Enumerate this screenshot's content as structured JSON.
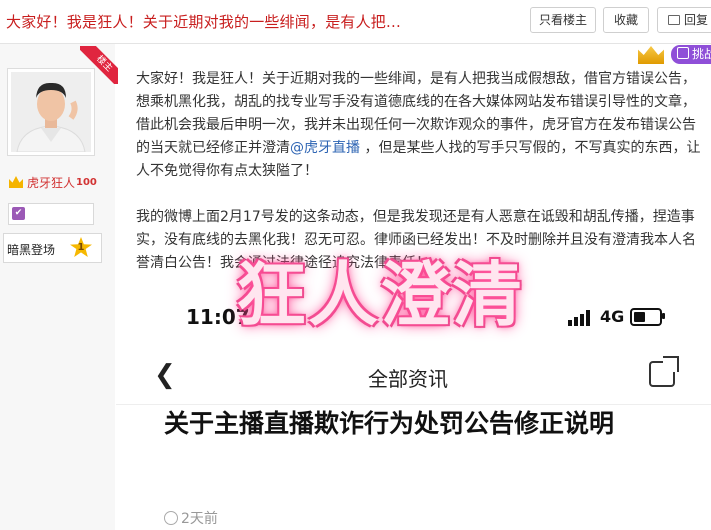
{
  "header": {
    "thread_title": "大家好！我是狂人！关于近期对我的一些绯闻，是有人把...",
    "only_op_label": "只看楼主",
    "favorite_label": "收藏",
    "reply_label": "回复"
  },
  "badges": {
    "louzhu_label": "楼主",
    "challenge_label": "挑战"
  },
  "author": {
    "name": "虎牙狂人",
    "name_suffix_icon": "100-emoji-icon",
    "level_name": "暗黑登场",
    "level_number": "1"
  },
  "post": {
    "para1_before_mention": "大家好！我是狂人！关于近期对我的一些绯闻，是有人把我当成假想敌，借官方错误公告，想乘机黑化我，胡乱的找专业写手没有道德底线的在各大媒体网站发布错误引导性的文章，借此机会我最后申明一次，我并未出现任何一次欺诈观众的事件，虎牙官方在发布错误公告的当天就已经修正并澄清",
    "mention": "@虎牙直播",
    "para1_after_mention": " ，但是某些人找的写手只写假的，不写真实的东西，让人不免觉得你有点太狭隘了！",
    "para2": "我的微博上面2月17号发的这条动态，但是我发现还是有人恶意在诋毁和胡乱传播，捏造事实，没有底线的去黑化我！忍无可忍。律师函已经发出！不及时删除并且没有澄清我本人名誉清白公告！我会通过法律途径追究法律责任！"
  },
  "screenshot": {
    "time": "11:07",
    "network": "4G",
    "battery_level": 0.45,
    "nav_title": "全部资讯",
    "article_title": "关于主播直播欺诈行为处罚公告修正说明",
    "age": "2天前"
  },
  "overlay_text": "狂人澄清",
  "colors": {
    "title_red": "#c81e1e",
    "username_red": "#d23333",
    "mention_blue": "#2d64b3",
    "louzhu_ribbon": "#e0253f",
    "challenge_purple": "#8f4fd8",
    "overlay_glow": "#ff3f8f"
  }
}
